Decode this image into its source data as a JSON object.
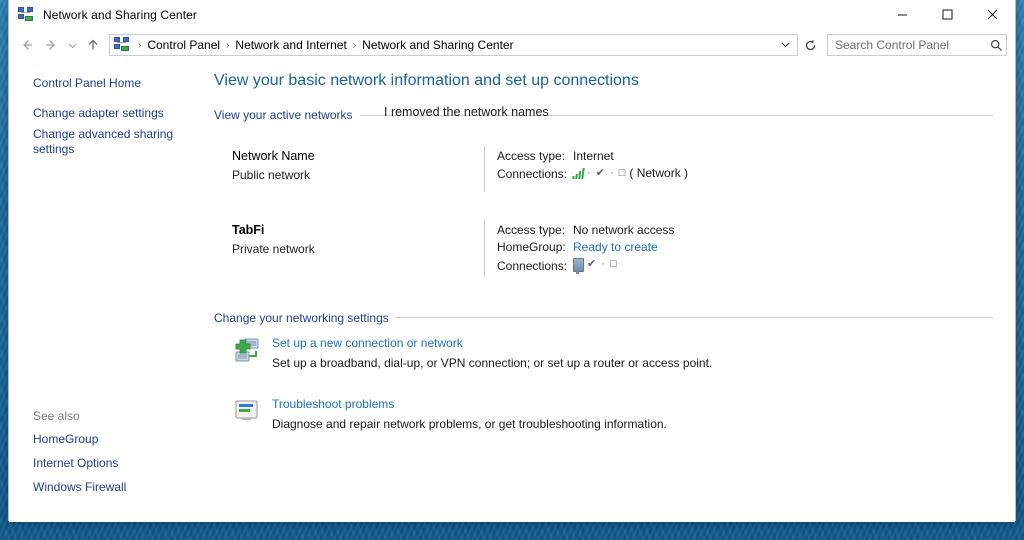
{
  "window": {
    "title": "Network and Sharing Center",
    "title_icon": "network-sharing-icon",
    "minimize_label": "Minimize",
    "maximize_label": "Maximize",
    "close_label": "Close"
  },
  "addressbar": {
    "back_icon": "back-arrow-icon",
    "forward_icon": "forward-arrow-icon",
    "recent_icon": "recent-locations-chevron-icon",
    "up_icon": "up-arrow-icon",
    "path_icon": "network-sharing-icon",
    "crumbs": [
      "Control Panel",
      "Network and Internet",
      "Network and Sharing Center"
    ],
    "separator": "›",
    "dropdown_icon": "chevron-down-icon",
    "refresh_icon": "refresh-icon"
  },
  "search": {
    "placeholder": "Search Control Panel",
    "value": "",
    "icon": "search-icon"
  },
  "sidebar": {
    "home_label": "Control Panel Home",
    "items": [
      {
        "label": "Change adapter settings"
      },
      {
        "label": "Change advanced sharing settings"
      }
    ],
    "see_also": {
      "title": "See also",
      "items": [
        {
          "label": "HomeGroup"
        },
        {
          "label": "Internet Options"
        },
        {
          "label": "Windows Firewall"
        }
      ]
    }
  },
  "main": {
    "page_title": "View your basic network information and set up connections",
    "active_networks_head": "View your active networks",
    "annotation": "I removed the network names",
    "networks": [
      {
        "name": "Network Name",
        "name_bold": false,
        "type": "Public network",
        "access_type_label": "Access type:",
        "access_type_value": "Internet",
        "connections_label": "Connections:",
        "connections_value": "· ✔ · □",
        "connections_suffix": "( Network  )",
        "connections_icon": "wifi-signal-icon",
        "homegroup_label": null,
        "homegroup_value": null
      },
      {
        "name": "TabFi",
        "name_bold": true,
        "type": "Private network",
        "access_type_label": "Access type:",
        "access_type_value": "No network access",
        "homegroup_label": "HomeGroup:",
        "homegroup_value": "Ready to create",
        "connections_label": "Connections:",
        "connections_value": "✔ · □",
        "connections_suffix": "",
        "connections_icon": "ethernet-icon"
      }
    ],
    "change_settings_head": "Change your networking settings",
    "settings_items": [
      {
        "icon": "new-connection-icon",
        "link": "Set up a new connection or network",
        "desc": "Set up a broadband, dial-up, or VPN connection; or set up a router or access point."
      },
      {
        "icon": "troubleshoot-icon",
        "link": "Troubleshoot problems",
        "desc": "Diagnose and repair network problems, or get troubleshooting information."
      }
    ]
  },
  "colors": {
    "title_blue": "#1762a6",
    "link_blue": "#1f6fc4",
    "sidebar_link": "#1f3f91",
    "desktop": "#1b6ea8"
  }
}
